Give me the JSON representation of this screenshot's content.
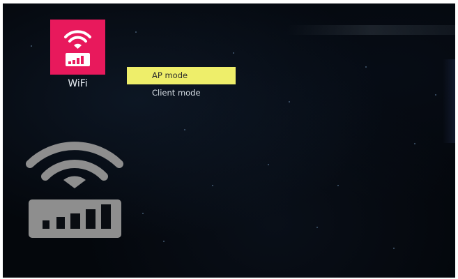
{
  "app": {
    "tile": {
      "label": "WiFi",
      "icon": "wifi-signal-icon",
      "background": "#e8195c"
    },
    "menu": {
      "items": [
        {
          "label": "AP mode",
          "selected": true
        },
        {
          "label": "Client mode",
          "selected": false
        }
      ],
      "highlight_color": "#eeee6a"
    },
    "preview_icon": "wifi-signal-large-icon"
  }
}
